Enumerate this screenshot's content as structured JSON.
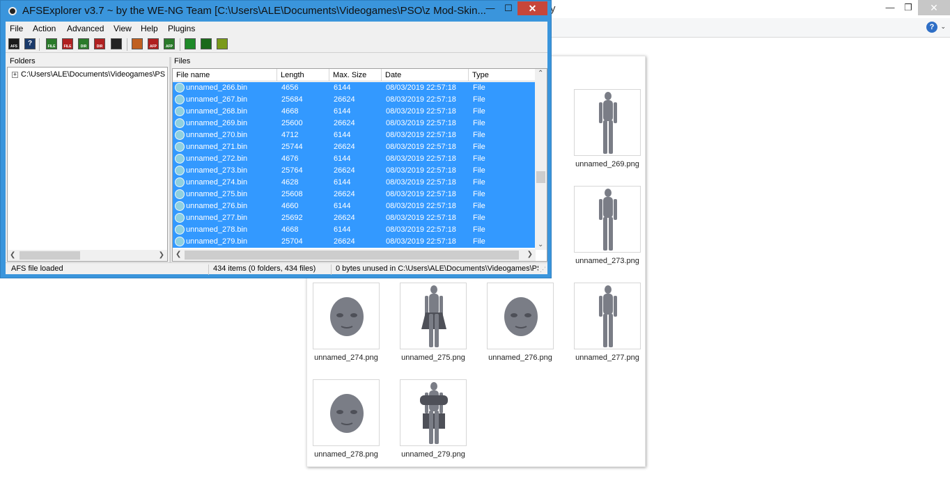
{
  "background_window": {
    "title_tail": "y",
    "controls": {
      "minimize": "—",
      "maximize": "❐",
      "close": "✕"
    },
    "help_label": "?",
    "thumbnails": [
      {
        "caption": "unnamed_269.png",
        "kind": "body"
      },
      {
        "caption": "unnamed_273.png",
        "kind": "body"
      },
      {
        "caption": "unnamed_274.png",
        "kind": "head"
      },
      {
        "caption": "unnamed_275.png",
        "kind": "body-dress"
      },
      {
        "caption": "unnamed_276.png",
        "kind": "head"
      },
      {
        "caption": "unnamed_277.png",
        "kind": "body"
      },
      {
        "caption": "unnamed_278.png",
        "kind": "head"
      },
      {
        "caption": "unnamed_279.png",
        "kind": "body-armor"
      }
    ]
  },
  "afs_window": {
    "title": "AFSExplorer v3.7  ~ by the WE-NG Team [C:\\Users\\ALE\\Documents\\Videogames\\PSO\\z Mod-Skin...",
    "controls": {
      "minimize": "—",
      "maximize": "☐",
      "close": "✕"
    },
    "menu": [
      "File",
      "Action",
      "Advanced",
      "View",
      "Help",
      "Plugins"
    ],
    "toolbar_icons": [
      {
        "name": "open-afs-icon",
        "label": "AFS",
        "color": "#1a1a1a"
      },
      {
        "name": "help-icon",
        "label": "?",
        "color": "#1a3a6a"
      },
      {
        "name": "extract-file-icon",
        "label": "FILE",
        "color": "#2a7a2a"
      },
      {
        "name": "replace-file-icon",
        "label": "FILE",
        "color": "#b02020"
      },
      {
        "name": "extract-dir-icon",
        "label": "DIR",
        "color": "#2a7a2a"
      },
      {
        "name": "replace-dir-icon",
        "label": "DIR",
        "color": "#b02020"
      },
      {
        "name": "search-binoculars-icon",
        "label": "",
        "color": "#222222"
      },
      {
        "name": "rebuild-icon",
        "label": "",
        "color": "#c06020"
      },
      {
        "name": "afp-icon-1",
        "label": "AFP",
        "color": "#b02020"
      },
      {
        "name": "afp-icon-2",
        "label": "AFP",
        "color": "#2a7a2a"
      },
      {
        "name": "tree-icon",
        "label": "",
        "color": "#1f8a2a"
      },
      {
        "name": "wave-icon",
        "label": "",
        "color": "#1a6a1a"
      },
      {
        "name": "edit-icon",
        "label": "",
        "color": "#7a9a1a"
      }
    ],
    "folders_label": "Folders",
    "files_label": "Files",
    "folder_path": "C:\\Users\\ALE\\Documents\\Videogames\\PS",
    "columns": [
      "File name",
      "Length",
      "Max. Size",
      "Date",
      "Type"
    ],
    "files": [
      {
        "name": "unnamed_266.bin",
        "length": "4656",
        "max": "6144",
        "date": "08/03/2019 22:57:18",
        "type": "File"
      },
      {
        "name": "unnamed_267.bin",
        "length": "25684",
        "max": "26624",
        "date": "08/03/2019 22:57:18",
        "type": "File"
      },
      {
        "name": "unnamed_268.bin",
        "length": "4668",
        "max": "6144",
        "date": "08/03/2019 22:57:18",
        "type": "File"
      },
      {
        "name": "unnamed_269.bin",
        "length": "25600",
        "max": "26624",
        "date": "08/03/2019 22:57:18",
        "type": "File"
      },
      {
        "name": "unnamed_270.bin",
        "length": "4712",
        "max": "6144",
        "date": "08/03/2019 22:57:18",
        "type": "File"
      },
      {
        "name": "unnamed_271.bin",
        "length": "25744",
        "max": "26624",
        "date": "08/03/2019 22:57:18",
        "type": "File"
      },
      {
        "name": "unnamed_272.bin",
        "length": "4676",
        "max": "6144",
        "date": "08/03/2019 22:57:18",
        "type": "File"
      },
      {
        "name": "unnamed_273.bin",
        "length": "25764",
        "max": "26624",
        "date": "08/03/2019 22:57:18",
        "type": "File"
      },
      {
        "name": "unnamed_274.bin",
        "length": "4628",
        "max": "6144",
        "date": "08/03/2019 22:57:18",
        "type": "File"
      },
      {
        "name": "unnamed_275.bin",
        "length": "25608",
        "max": "26624",
        "date": "08/03/2019 22:57:18",
        "type": "File"
      },
      {
        "name": "unnamed_276.bin",
        "length": "4660",
        "max": "6144",
        "date": "08/03/2019 22:57:18",
        "type": "File"
      },
      {
        "name": "unnamed_277.bin",
        "length": "25692",
        "max": "26624",
        "date": "08/03/2019 22:57:18",
        "type": "File"
      },
      {
        "name": "unnamed_278.bin",
        "length": "4668",
        "max": "6144",
        "date": "08/03/2019 22:57:18",
        "type": "File"
      },
      {
        "name": "unnamed_279.bin",
        "length": "25704",
        "max": "26624",
        "date": "08/03/2019 22:57:18",
        "type": "File"
      }
    ],
    "status": {
      "state": "AFS file loaded",
      "items": "434 items (0 folders, 434 files)",
      "unused": "0 bytes unused in C:\\Users\\ALE\\Documents\\Videogames\\PS"
    },
    "colors": {
      "selection": "#3399ff",
      "frame": "#3a95dc"
    }
  }
}
